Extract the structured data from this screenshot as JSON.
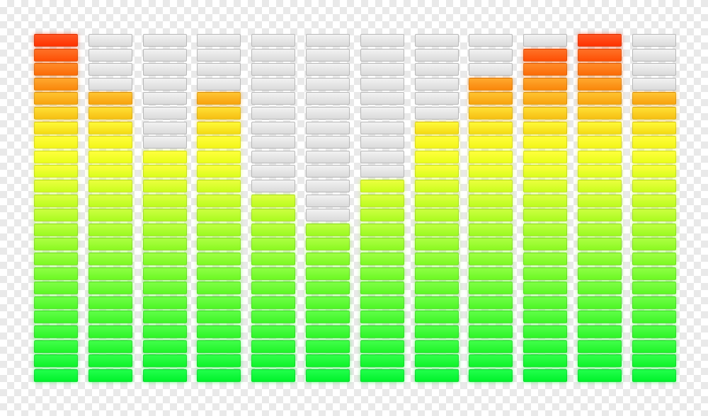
{
  "equalizer": {
    "segments_per_band": 24,
    "band_levels": [
      24,
      20,
      16,
      20,
      13,
      11,
      14,
      18,
      21,
      23,
      24,
      20
    ],
    "colors": {
      "low": "#00f22a",
      "mid": "#f2ff1a",
      "high": "#ff3300",
      "unlit": "#e0e0e0"
    }
  }
}
